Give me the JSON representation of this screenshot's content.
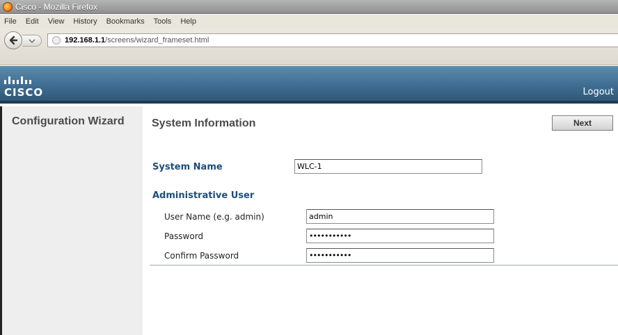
{
  "window": {
    "title": "Cisco - Mozilla Firefox"
  },
  "menu": {
    "items": [
      "File",
      "Edit",
      "View",
      "History",
      "Bookmarks",
      "Tools",
      "Help"
    ]
  },
  "nav": {
    "url_host": "192.168.1.1",
    "url_path": "/screens/wizard_frameset.html"
  },
  "header": {
    "logo_text": "CISCO",
    "logout_label": "Logout",
    "brand_color": "#3d6b8f"
  },
  "sidebar": {
    "title": "Configuration Wizard"
  },
  "main": {
    "page_title": "System Information",
    "next_label": "Next",
    "system_name_label": "System Name",
    "system_name_value": "WLC-1",
    "admin_section_label": "Administrative User",
    "username_label": "User Name (e.g. admin)",
    "username_value": "admin",
    "password_label": "Password",
    "password_value": "•••••••••••",
    "confirm_label": "Confirm Password",
    "confirm_value": "•••••••••••"
  }
}
